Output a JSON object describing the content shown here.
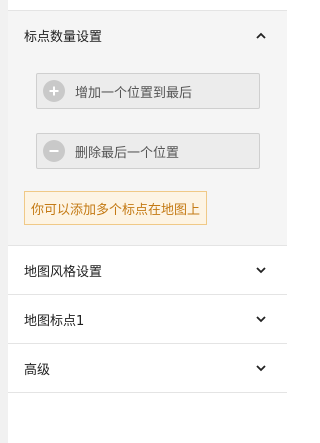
{
  "sections": [
    {
      "title": "标点数量设置",
      "expanded": true
    },
    {
      "title": "地图风格设置",
      "expanded": false
    },
    {
      "title": "地图标点1",
      "expanded": false
    },
    {
      "title": "高级",
      "expanded": false
    }
  ],
  "marker_count": {
    "add_label": "增加一个位置到最后",
    "remove_label": "删除最后一个位置",
    "hint": "你可以添加多个标点在地图上"
  },
  "icons": {
    "add": "plus-circle-icon",
    "remove": "minus-circle-icon",
    "expanded": "chevron-up-icon",
    "collapsed": "chevron-down-icon"
  },
  "colors": {
    "hint_text": "#c47a14",
    "hint_bg": "#fdf4e4",
    "hint_border": "#f0c987",
    "button_bg": "#ececec",
    "section_bg": "#f5f5f5"
  }
}
